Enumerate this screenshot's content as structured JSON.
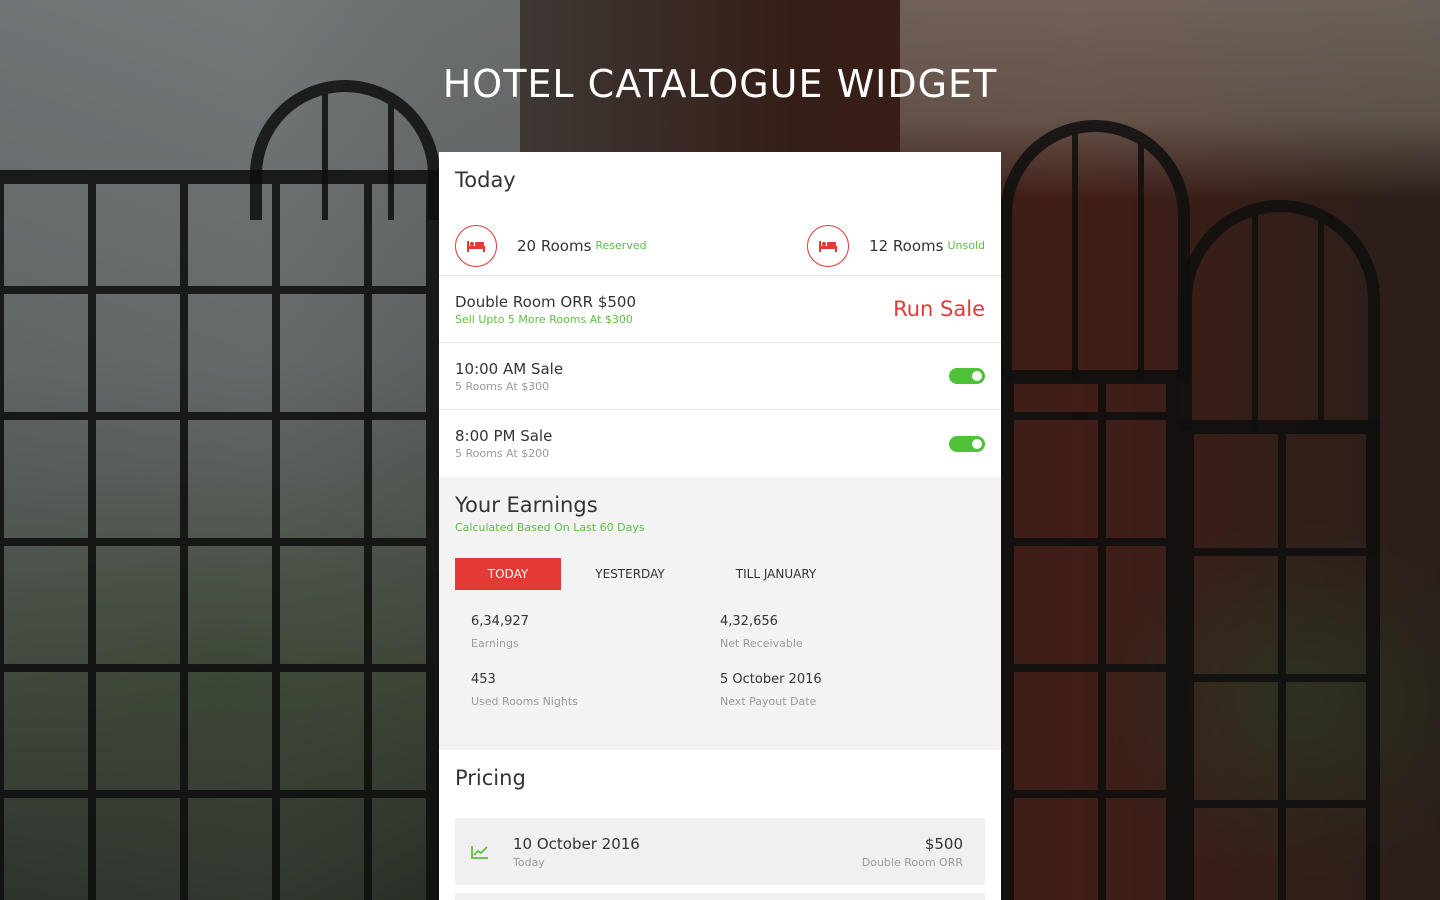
{
  "page": {
    "title": "HOTEL CATALOGUE WIDGET"
  },
  "today": {
    "heading": "Today",
    "reserved": {
      "count_label": "20 Rooms",
      "tag": "Reserved",
      "icon": "bed-icon"
    },
    "unsold": {
      "count_label": "12 Rooms",
      "tag": "Unsold",
      "icon": "bed-icon"
    },
    "offer": {
      "title": "Double Room ORR $500",
      "subtitle": "Sell Upto 5 More Rooms At $300",
      "action": "Run Sale"
    },
    "sales": [
      {
        "title": "10:00 AM Sale",
        "subtitle": "5 Rooms At $300",
        "enabled": true
      },
      {
        "title": "8:00 PM Sale",
        "subtitle": "5 Rooms At $200",
        "enabled": true
      }
    ]
  },
  "earnings": {
    "heading": "Your Earnings",
    "subtitle": "Calculated Based On Last 60 Days",
    "tabs": [
      "TODAY",
      "YESTERDAY",
      "TILL JANUARY"
    ],
    "active_tab": "TODAY",
    "stats": [
      {
        "value": "6,34,927",
        "label": "Earnings"
      },
      {
        "value": "4,32,656",
        "label": "Net Receivable"
      },
      {
        "value": "453",
        "label": "Used Rooms Nights"
      },
      {
        "value": "5 October 2016",
        "label": "Next Payout Date"
      }
    ]
  },
  "pricing": {
    "heading": "Pricing",
    "items": [
      {
        "date": "10 October 2016",
        "day": "Today",
        "amount": "$500",
        "room": "Double Room ORR",
        "icon": "trend-up-icon"
      }
    ]
  },
  "colors": {
    "accent": "#e53935",
    "green": "#5cbf3f",
    "toggle_on": "#4fc23a"
  }
}
